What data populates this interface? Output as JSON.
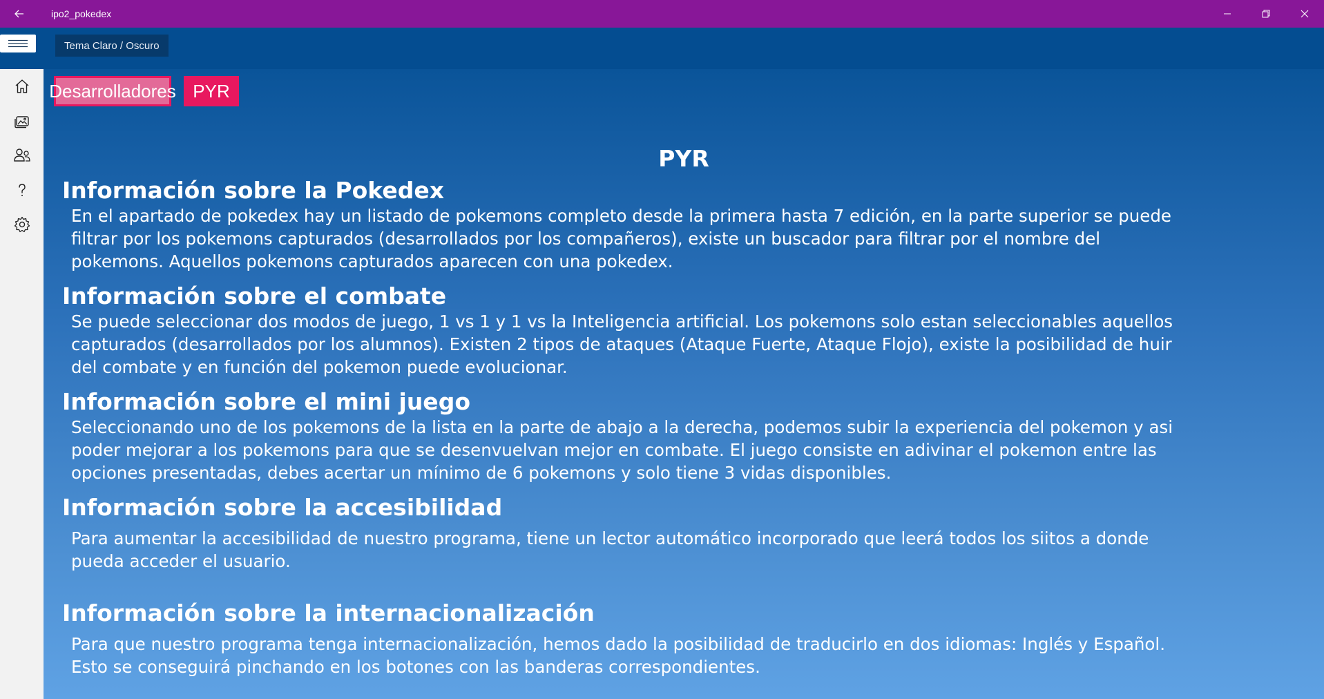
{
  "window": {
    "title": "ipo2_pokedex",
    "accent": "#881798"
  },
  "toolbar": {
    "menu_icon": "hamburger-icon",
    "theme_button": "Tema Claro / Oscuro"
  },
  "nav": {
    "items": [
      {
        "icon": "home-icon"
      },
      {
        "icon": "gallery-icon"
      },
      {
        "icon": "people-icon"
      },
      {
        "icon": "help-icon"
      },
      {
        "icon": "gear-icon"
      }
    ]
  },
  "tabs": {
    "developers": "Desarrolladores",
    "pyr": "PYR",
    "active_color": "#e8185f"
  },
  "main": {
    "title": "PYR",
    "sections": [
      {
        "heading": "Información sobre la Pokedex",
        "lines": [
          "En el apartado de pokedex hay un listado de pokemons completo desde la primera hasta 7 edición, en la parte superior se puede",
          "filtrar por los pokemons capturados (desarrollados por los compañeros), existe un buscador para filtrar por el nombre del",
          "pokemons. Aquellos pokemons capturados aparecen con una pokedex."
        ]
      },
      {
        "heading": "Información sobre el combate",
        "lines": [
          "Se puede seleccionar dos modos de juego, 1 vs 1 y 1 vs la Inteligencia artificial. Los pokemons solo estan seleccionables aquellos",
          "capturados (desarrollados por los alumnos). Existen 2 tipos de ataques (Ataque Fuerte, Ataque Flojo), existe la posibilidad de huir",
          "del combate y en función del pokemon puede evolucionar."
        ]
      },
      {
        "heading": "Información sobre el mini juego",
        "lines": [
          "Seleccionando uno de los pokemons de la lista en la parte de abajo a la derecha, podemos subir la experiencia del pokemon y asi",
          "poder mejorar a los pokemons para que se desenvuelvan mejor en combate. El juego consiste en adivinar el pokemon entre las",
          "opciones presentadas, debes acertar un mínimo de 6 pokemons y solo tiene 3 vidas disponibles."
        ]
      },
      {
        "heading": "Información sobre la accesibilidad",
        "lines": [
          "Para aumentar la accesibilidad de nuestro programa, tiene un lector automático incorporado que leerá todos los siitos a donde",
          "pueda acceder el usuario."
        ]
      },
      {
        "heading": "Información sobre la internacionalización",
        "lines": [
          "Para que nuestro programa tenga internacionalización, hemos dado la posibilidad de traducirlo en dos idiomas: Inglés y Español.",
          "Esto se conseguirá pinchando en los botones con las banderas correspondientes."
        ]
      }
    ]
  }
}
